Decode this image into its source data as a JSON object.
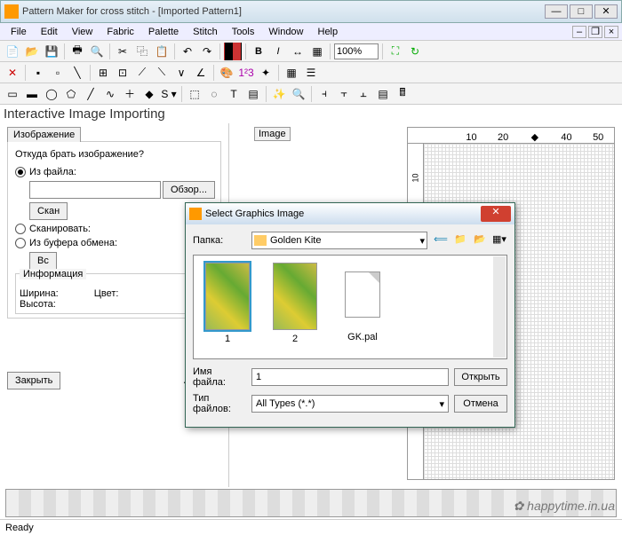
{
  "window": {
    "title": "Pattern Maker for cross stitch - [Imported Pattern1]"
  },
  "menu": [
    "File",
    "Edit",
    "View",
    "Fabric",
    "Palette",
    "Stitch",
    "Tools",
    "Window",
    "Help"
  ],
  "toolbar": {
    "zoom": "100%"
  },
  "panel": {
    "title": "Interactive Image Importing",
    "tab": "Изображение",
    "question": "Откуда брать изображение?",
    "radio_file": "Из файла:",
    "browse": "Обзор...",
    "scan_btn": "Скан",
    "radio_scan": "Сканировать:",
    "radio_clip": "Из буфера обмена:",
    "paste_btn": "Вс",
    "info_title": "Информация",
    "width": "Ширина:",
    "height": "Высота:",
    "color": "Цвет:",
    "close": "Закрыть",
    "auto": "Авто"
  },
  "canvas": {
    "image_label": "Image",
    "ruler": [
      "",
      "10",
      "20",
      "",
      "40",
      "50"
    ]
  },
  "dialog": {
    "title": "Select Graphics Image",
    "folder_label": "Папка:",
    "folder_value": "Golden Kite",
    "files": [
      {
        "name": "1",
        "type": "img",
        "selected": true
      },
      {
        "name": "2",
        "type": "img",
        "selected": false
      },
      {
        "name": "GK.pal",
        "type": "doc",
        "selected": false
      }
    ],
    "filename_label": "Имя файла:",
    "filename_value": "1",
    "filetype_label": "Тип файлов:",
    "filetype_value": "All Types (*.*)",
    "open": "Открыть",
    "cancel": "Отмена"
  },
  "status": "Ready",
  "watermark": "✿ happytime.in.ua"
}
